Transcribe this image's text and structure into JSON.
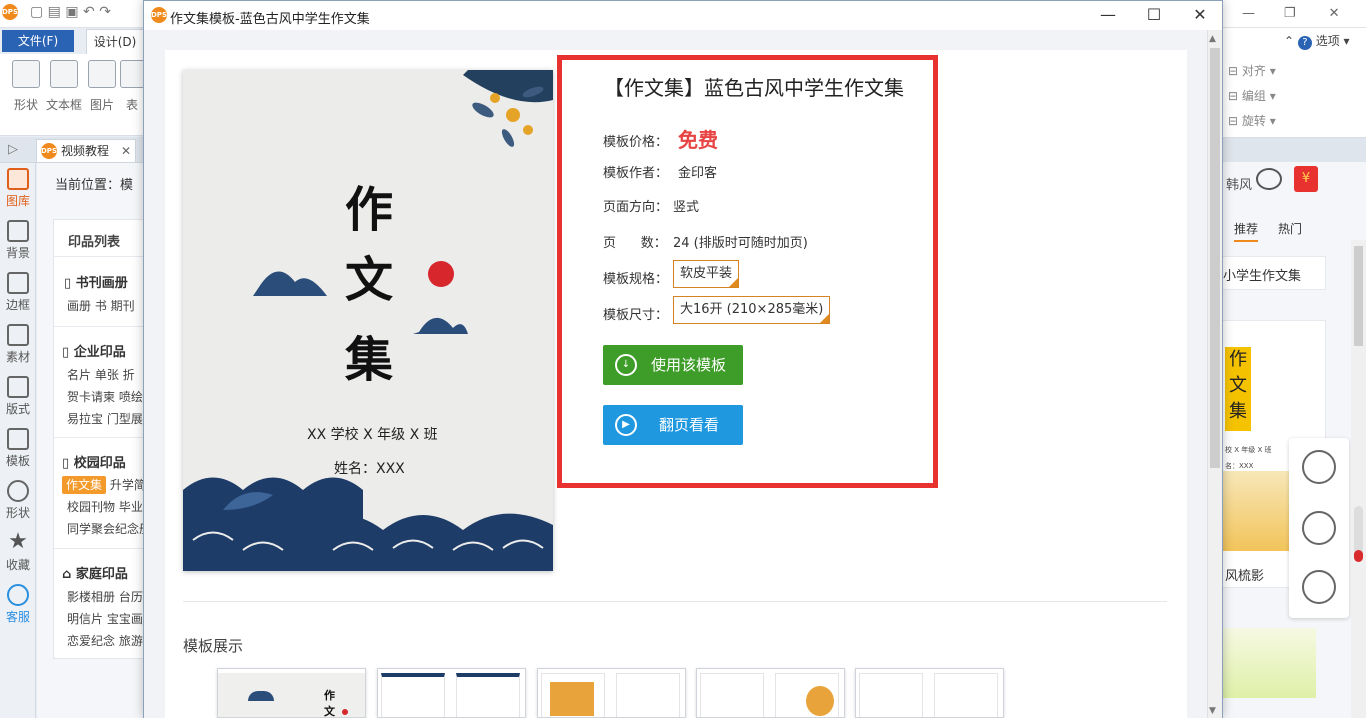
{
  "app": {
    "ribbon_tabs": {
      "file": "文件(F)",
      "design": "设计(D)"
    },
    "ribbon_items": [
      "形状",
      "文本框",
      "图片",
      "表"
    ],
    "doc_tab": "视频教程",
    "left_nav": [
      "图库",
      "背景",
      "边框",
      "素材",
      "版式",
      "模板",
      "形状",
      "收藏",
      "客服"
    ],
    "breadcrumb": "当前位置：模",
    "print_list": {
      "title": "印品列表",
      "sections": [
        {
          "heading": "书刊画册",
          "rows": [
            "画册  书  期刊"
          ]
        },
        {
          "heading": "企业印品",
          "rows": [
            "名片  单张  折",
            "贺卡请柬  喷绘",
            "易拉宝  门型展"
          ]
        },
        {
          "heading": "校园印品",
          "rows": [
            "作文集  升学简",
            "校园刊物  毕业",
            "同学聚会纪念册"
          ]
        },
        {
          "heading": "家庭印品",
          "rows": [
            "影楼相册  台历",
            "明信片  宝宝画",
            "恋爱纪念  旅游"
          ]
        }
      ],
      "active_chip": "作文集"
    },
    "right_panel": {
      "options_label": "选项",
      "align": "对齐",
      "group": "编组",
      "rotate": "旋转",
      "style_label": "韩风",
      "tabs": [
        "推荐",
        "热门"
      ],
      "card_title": "小学生作文集",
      "card2_caption": "风梳影",
      "card1_chars": [
        "作",
        "文",
        "集"
      ],
      "card1_school": "校 X 年级 X 班",
      "card1_name": "名：XXX"
    }
  },
  "dialog": {
    "title": "作文集模板-蓝色古风中学生作文集",
    "controls": {
      "minimize": "—",
      "maximize": "☐",
      "close": "✕"
    },
    "cover": {
      "chars": [
        "作",
        "文",
        "集"
      ],
      "school": "XX 学校 X 年级 X 班",
      "name": "姓名：XXX"
    },
    "info": {
      "title": "【作文集】蓝色古风中学生作文集",
      "price_label": "模板价格：",
      "price_value": "免费",
      "author_label": "模板作者：",
      "author_value": "金印客",
      "orientation_label": "页面方向：",
      "orientation_value": "竖式",
      "pages_label": "页      数：",
      "pages_value": "24 (排版时可随时加页)",
      "spec_label": "模板规格：",
      "spec_value": "软皮平装",
      "size_label": "模板尺寸：",
      "size_value": "大16开 (210×285毫米)",
      "use_button": "使用该模板",
      "preview_button": "翻页看看"
    },
    "showcase_title": "模板展示"
  },
  "colors": {
    "accent_red": "#e8322f",
    "price_red": "#e84343",
    "use_green": "#3e9d28",
    "preview_blue": "#1f98e0",
    "active_orange": "#e0601b"
  }
}
